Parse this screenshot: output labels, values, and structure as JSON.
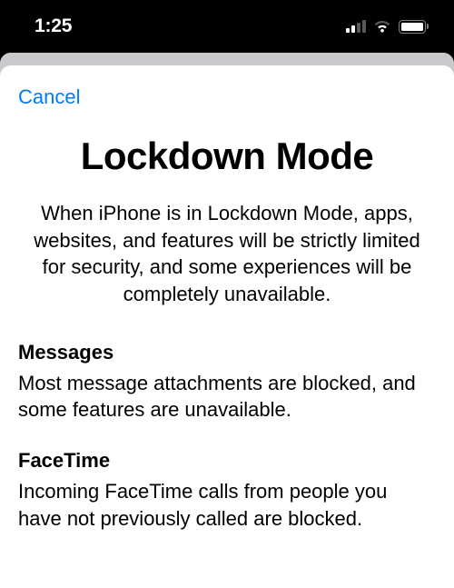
{
  "status": {
    "time": "1:25"
  },
  "sheet": {
    "cancel_label": "Cancel",
    "title": "Lockdown Mode",
    "intro": "When iPhone is in Lockdown Mode, apps, websites, and features will be strictly limited for security, and some experiences will be completely unavailable.",
    "sections": [
      {
        "title": "Messages",
        "body": "Most message attachments are blocked, and some features are unavailable."
      },
      {
        "title": "FaceTime",
        "body": "Incoming FaceTime calls from people you have not previously called are blocked."
      }
    ]
  }
}
